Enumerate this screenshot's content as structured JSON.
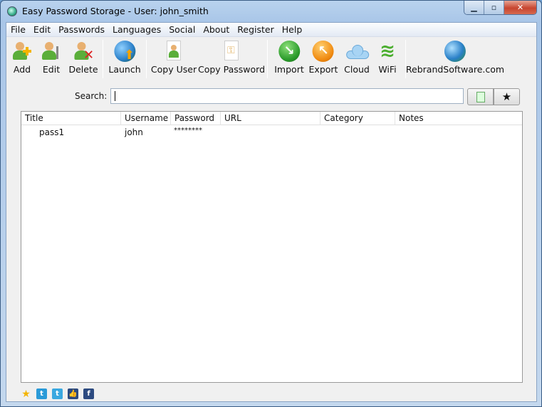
{
  "window": {
    "title": "Easy Password Storage - User: john_smith",
    "controls": [
      "minimize",
      "maximize",
      "close"
    ]
  },
  "menu": [
    "File",
    "Edit",
    "Passwords",
    "Languages",
    "Social",
    "About",
    "Register",
    "Help"
  ],
  "toolbar": [
    {
      "label": "Add",
      "icon": "user-add-icon"
    },
    {
      "label": "Edit",
      "icon": "user-edit-icon"
    },
    {
      "label": "Delete",
      "icon": "user-delete-icon"
    },
    {
      "label": "Launch",
      "icon": "globe-launch-icon"
    },
    {
      "label": "Copy User",
      "icon": "copy-user-icon"
    },
    {
      "label": "Copy Password",
      "icon": "copy-password-icon"
    },
    {
      "label": "Import",
      "icon": "import-icon"
    },
    {
      "label": "Export",
      "icon": "export-icon"
    },
    {
      "label": "Cloud",
      "icon": "cloud-icon"
    },
    {
      "label": "WiFi",
      "icon": "wifi-icon"
    },
    {
      "label": "RebrandSoftware.com",
      "icon": "globe-icon"
    }
  ],
  "search": {
    "label": "Search:",
    "value": "",
    "list_button_icon": "list-icon",
    "favorite_button_label": "★"
  },
  "table": {
    "columns": [
      "Title",
      "Username",
      "Password",
      "URL",
      "Category",
      "Notes"
    ],
    "rows": [
      {
        "title": "pass1",
        "username": "john",
        "password": "********",
        "url": "",
        "category": "",
        "notes": ""
      }
    ]
  },
  "footer": {
    "icons": [
      "star-icon",
      "twitter-icon",
      "twitter-share-icon",
      "like-icon",
      "facebook-icon"
    ],
    "facebook_glyph": "f"
  }
}
